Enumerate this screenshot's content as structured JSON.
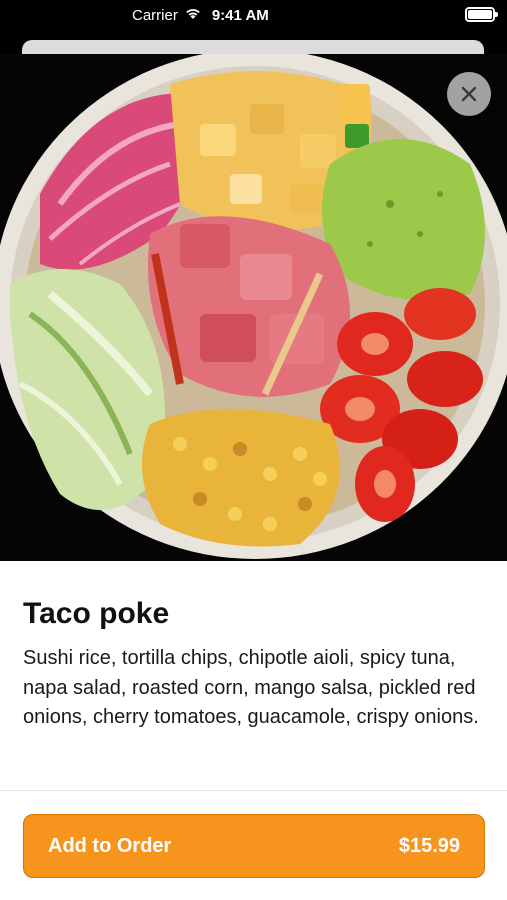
{
  "status_bar": {
    "carrier": "Carrier",
    "time": "9:41 AM",
    "wifi_icon": "wifi-icon",
    "battery_icon": "battery-icon"
  },
  "photo": {
    "description_icon": "food-photo"
  },
  "close_icon": "close-icon",
  "item": {
    "title": "Taco poke",
    "description": "Sushi rice, tortilla chips, chipotle aioli, spicy tuna, napa salad, roasted corn, mango salsa, pickled red onions, cherry tomatoes, guacamole, crispy onions."
  },
  "order_button": {
    "label": "Add to Order",
    "price": "$15.99"
  },
  "colors": {
    "accent": "#f7941d",
    "background": "#ffffff"
  }
}
